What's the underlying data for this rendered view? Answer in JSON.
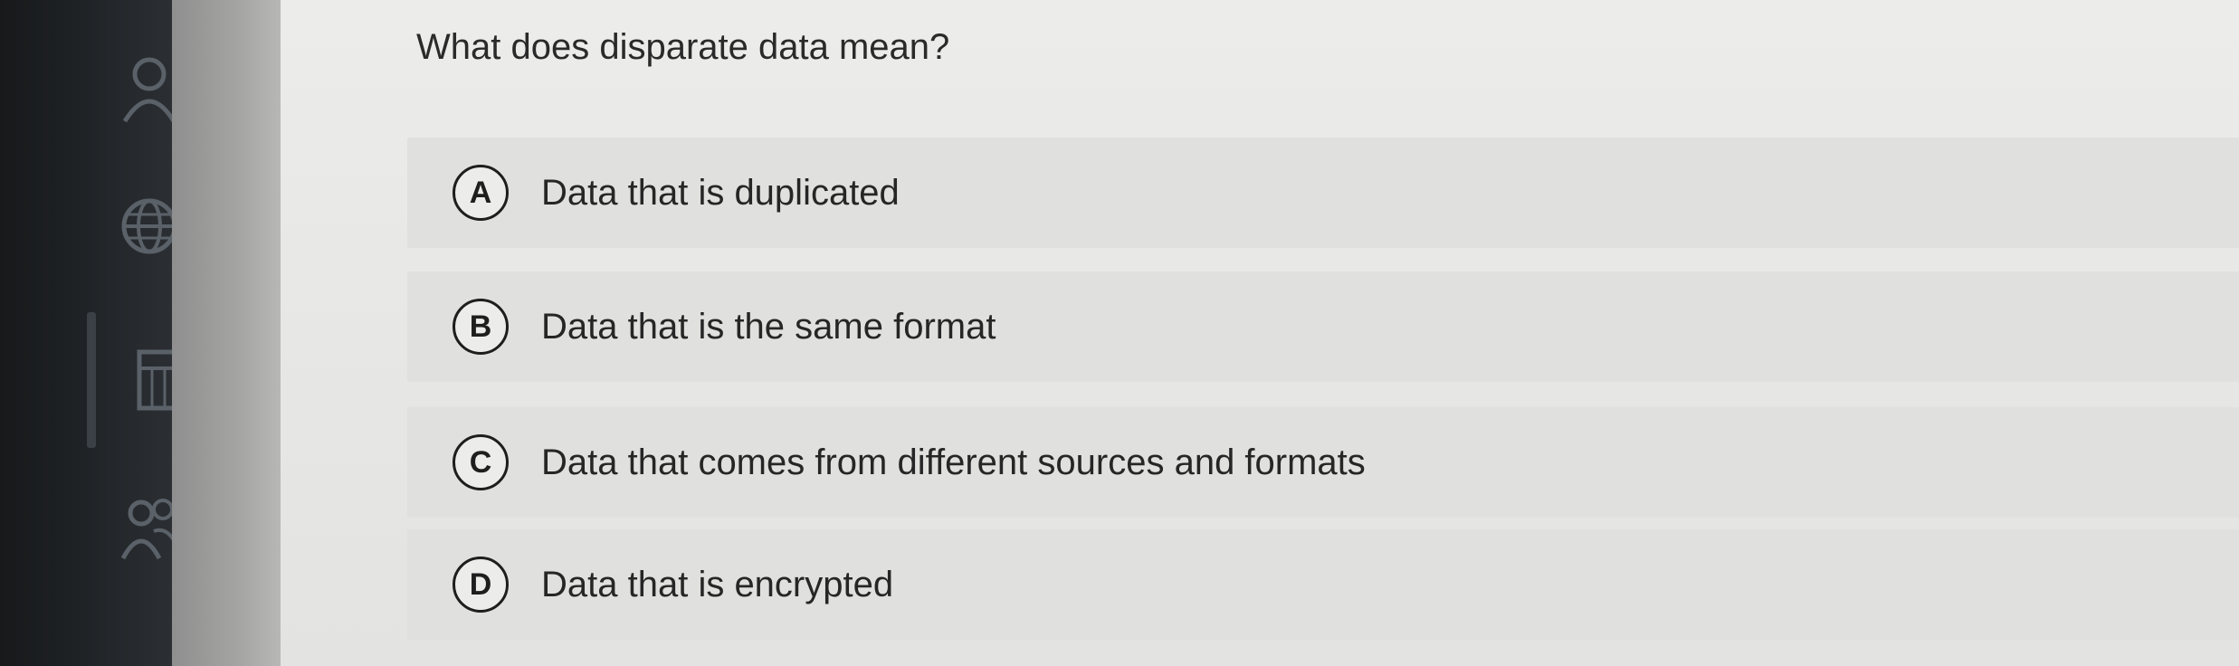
{
  "question": {
    "text": "What does disparate data mean?"
  },
  "options": [
    {
      "letter": "A",
      "text": "Data that is duplicated"
    },
    {
      "letter": "B",
      "text": "Data that is the same format"
    },
    {
      "letter": "C",
      "text": "Data that comes from different sources and formats"
    },
    {
      "letter": "D",
      "text": "Data that is encrypted"
    }
  ],
  "sidebar": {
    "icons": [
      "user-icon",
      "globe-icon",
      "calculator-icon",
      "users-icon"
    ]
  }
}
